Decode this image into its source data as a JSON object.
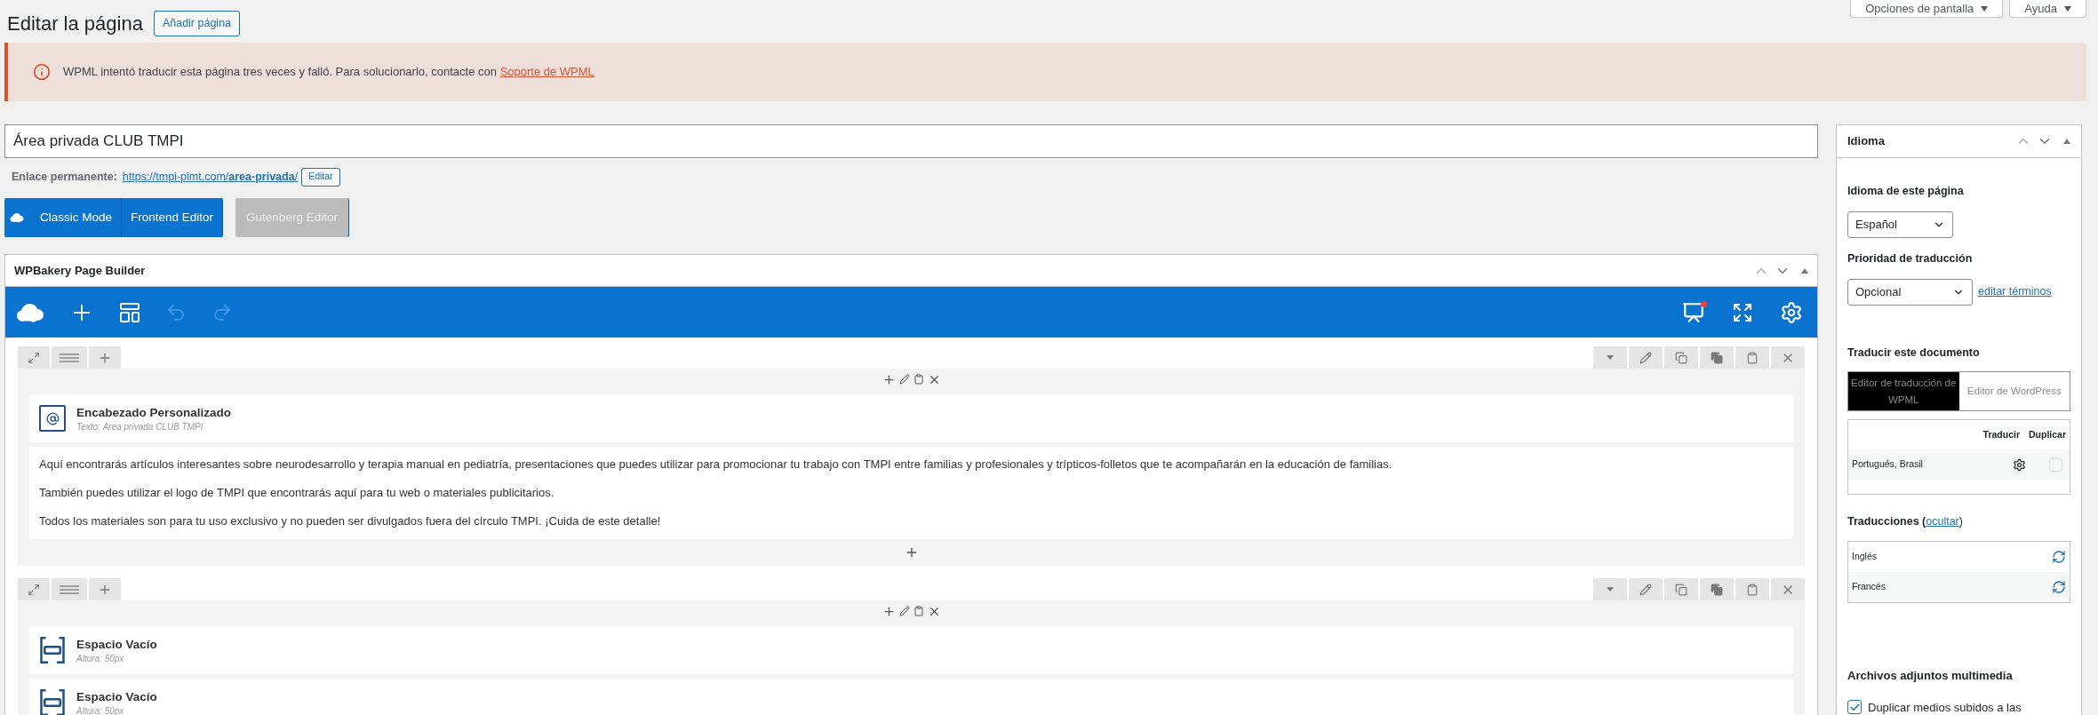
{
  "header": {
    "title": "Editar la página",
    "add_button": "Añadir página"
  },
  "screen_tabs": [
    {
      "label": "Opciones de pantalla"
    },
    {
      "label": "Ayuda"
    }
  ],
  "notice": {
    "text": "WPML intentó traducir esta página tres veces y falló. Para solucionarlo, contacte con",
    "link": "Soporte de WPML"
  },
  "post_title": {
    "value": "Área privada CLUB TMPI"
  },
  "permalink": {
    "label": "Enlace permanente:",
    "url": "https://tmpi-pimt.com/**area-privada**/",
    "edit_button": "Editar"
  },
  "editor_modes": [
    {
      "label": "Classic Mode",
      "kind": "classic",
      "disabled": false
    },
    {
      "label": "Frontend Editor",
      "kind": "frontend",
      "disabled": false
    },
    {
      "label": "Gutenberg Editor",
      "kind": "gutenberg",
      "disabled": true
    }
  ],
  "builder": {
    "title": "WPBakery Page Builder",
    "rows": [
      {
        "elements": [
          {
            "kind": "heading",
            "title": "Encabezado Personalizado",
            "subtitle": "Texto: Área privada CLUB TMPI"
          },
          {
            "kind": "text",
            "paragraphs": [
              "Aquí encontrarás artículos interesantes sobre neurodesarrollo y terapia manual en pediatría, presentaciones que puedes utilizar para promocionar tu trabajo con TMPI entre familias y profesionales y trípticos-folletos que te acompañarán en la educación de familias.",
              "También puedes utilizar el logo de TMPI que encontrarás aquí para tu web o materiales publicitarios.",
              "Todos los materiales son para tu uso exclusivo y no pueden ser divulgados fuera del círculo TMPI. ¡Cuida de este detalle!"
            ]
          }
        ]
      },
      {
        "elements": [
          {
            "kind": "spacer",
            "title": "Espacio Vacío",
            "subtitle": "Altura: 50px"
          },
          {
            "kind": "spacer",
            "title": "Espacio Vacío",
            "subtitle": "Altura: 50px"
          }
        ]
      }
    ]
  },
  "sidebar": {
    "title": "Idioma",
    "language_label": "Idioma de este página",
    "language": "Español",
    "priority_label": "Prioridad de traducción",
    "priority": "Opcional",
    "edit_terms": "editar términos",
    "translate_label": "Traducir este documento",
    "editor_options": [
      {
        "label": "Editor de traducción de WPML",
        "selected": true
      },
      {
        "label": "Editor de WordPress",
        "selected": false
      }
    ],
    "table_headers": [
      "Traducir",
      "Duplicar"
    ],
    "translate_rows": [
      {
        "language": "Portugués, Brasil",
        "duplicate": false
      }
    ],
    "translations_heading": {
      "before": "Traducciones (",
      "link": "ocultar",
      "after": ")"
    },
    "translations": [
      {
        "language": "Inglés"
      },
      {
        "language": "Francés"
      }
    ],
    "attachments_label": "Archivos adjuntos multimedia",
    "duplicate_media": {
      "label": "Duplicar medios subidos a las",
      "checked": true
    }
  }
}
